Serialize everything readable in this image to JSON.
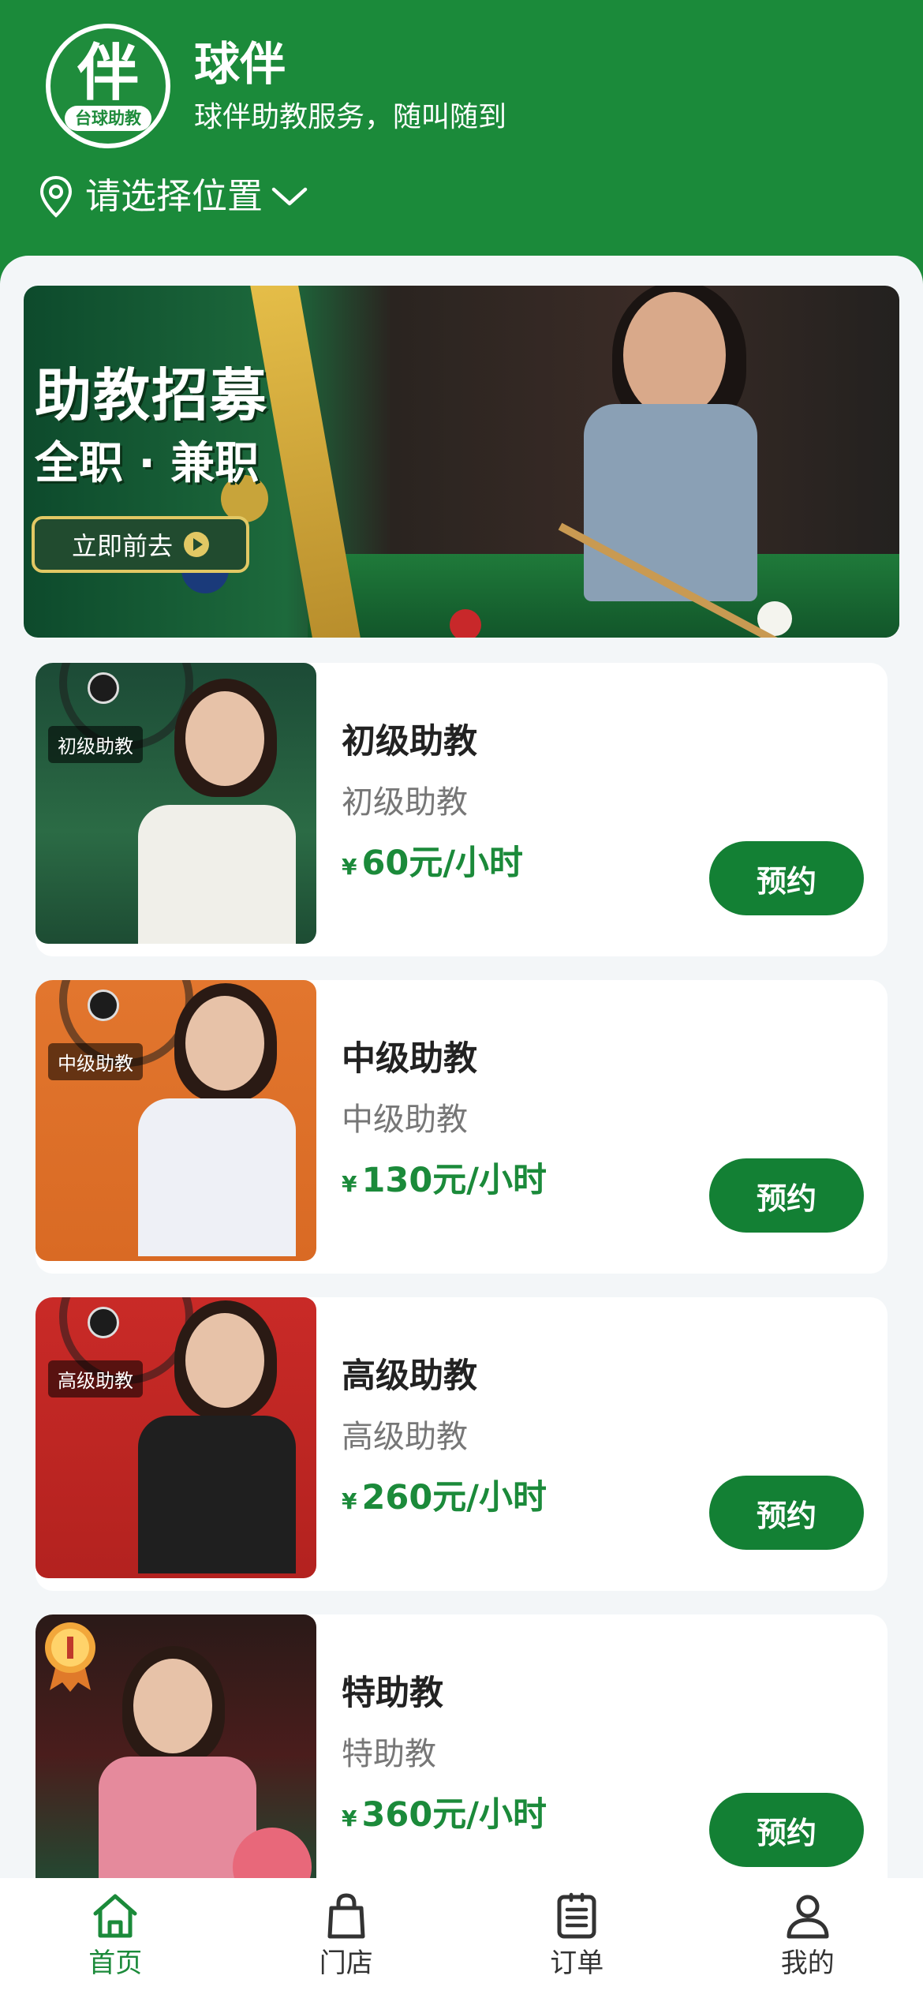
{
  "header": {
    "logo_text": "伴",
    "logo_subtext": "台球助教",
    "app_name": "球伴",
    "slogan": "球伴助教服务，随叫随到",
    "location_label": "请选择位置"
  },
  "banner": {
    "title": "助教招募",
    "subtitle": "全职 · 兼职",
    "cta_label": "立即前去"
  },
  "coaches": [
    {
      "thumb_tag": "初级助教",
      "title": "初级助教",
      "subtitle": "初级助教",
      "currency": "¥",
      "price": "60元/小时",
      "book_label": "预约"
    },
    {
      "thumb_tag": "中级助教",
      "title": "中级助教",
      "subtitle": "中级助教",
      "currency": "¥",
      "price": "130元/小时",
      "book_label": "预约"
    },
    {
      "thumb_tag": "高级助教",
      "title": "高级助教",
      "subtitle": "高级助教",
      "currency": "¥",
      "price": "260元/小时",
      "book_label": "预约"
    },
    {
      "title": "特助教",
      "subtitle": "特助教",
      "currency": "¥",
      "price": "360元/小时",
      "book_label": "预约"
    }
  ],
  "tabbar": {
    "items": [
      {
        "label": "首页",
        "icon": "home-icon",
        "active": true
      },
      {
        "label": "门店",
        "icon": "shopping-bag-icon",
        "active": false
      },
      {
        "label": "订单",
        "icon": "order-list-icon",
        "active": false
      },
      {
        "label": "我的",
        "icon": "user-icon",
        "active": false
      }
    ]
  },
  "colors": {
    "brand_green": "#1b8a3a",
    "button_green": "#138034",
    "background": "#f3f6f8"
  }
}
